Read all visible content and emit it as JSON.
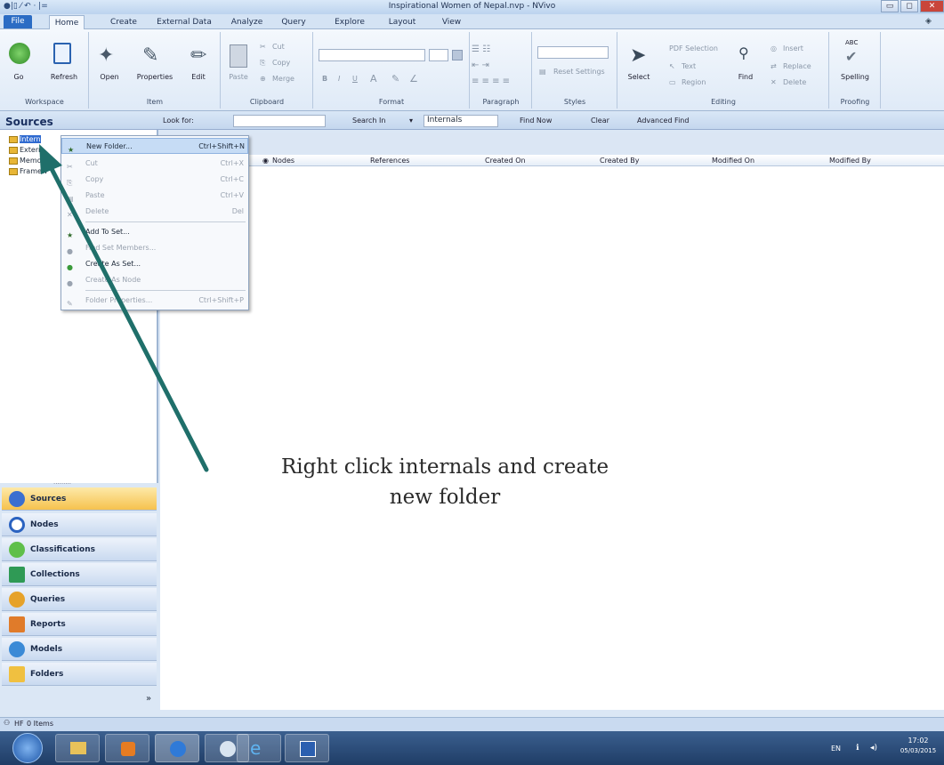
{
  "window": {
    "title": "Inspirational Women of Nepal.nvp - NVivo",
    "qat": "●|▯ ⁄ ↶ · |="
  },
  "tabs": [
    "File",
    "Home",
    "Create",
    "External Data",
    "Analyze",
    "Query",
    "Explore",
    "Layout",
    "View"
  ],
  "ribbon": {
    "workspace": {
      "go": "Go",
      "refresh": "Refresh",
      "label": "Workspace"
    },
    "item": {
      "open": "Open",
      "properties": "Properties",
      "edit": "Edit",
      "label": "Item"
    },
    "clipboard": {
      "paste": "Paste",
      "cut": "Cut",
      "copy": "Copy",
      "merge": "Merge",
      "label": "Clipboard"
    },
    "format": {
      "label": "Format",
      "bold": "B",
      "italic": "I",
      "underline": "U",
      "font_color": "A"
    },
    "paragraph": {
      "label": "Paragraph"
    },
    "styles": {
      "reset": "Reset Settings",
      "label": "Styles"
    },
    "editing": {
      "select": "Select",
      "pdf_selection": "PDF Selection",
      "text": "Text",
      "region": "Region",
      "find": "Find",
      "insert": "Insert",
      "replace": "Replace",
      "delete": "Delete",
      "label": "Editing"
    },
    "proofing": {
      "spelling": "Spelling",
      "abc": "ABC",
      "label": "Proofing"
    }
  },
  "searchbar": {
    "sources": "Sources",
    "look_for": "Look for:",
    "search_in": "Search In",
    "search_in_value": "Internals",
    "find_now": "Find Now",
    "clear": "Clear",
    "advanced_find": "Advanced Find"
  },
  "tree": [
    "Intern",
    "Extern",
    "Memo",
    "Framew"
  ],
  "columns": [
    "Nodes",
    "References",
    "Created On",
    "Created By",
    "Modified On",
    "Modified By"
  ],
  "context_menu": [
    {
      "label": "New Folder...",
      "shortcut": "Ctrl+Shift+N",
      "disabled": false
    },
    {
      "label": "Cut",
      "shortcut": "Ctrl+X",
      "disabled": true
    },
    {
      "label": "Copy",
      "shortcut": "Ctrl+C",
      "disabled": true
    },
    {
      "label": "Paste",
      "shortcut": "Ctrl+V",
      "disabled": true
    },
    {
      "label": "Delete",
      "shortcut": "Del",
      "disabled": true
    },
    {
      "label": "Add To Set...",
      "shortcut": "",
      "disabled": false
    },
    {
      "label": "Find Set Members...",
      "shortcut": "",
      "disabled": true
    },
    {
      "label": "Create As Set...",
      "shortcut": "",
      "disabled": false
    },
    {
      "label": "Create As Node",
      "shortcut": "",
      "disabled": true
    },
    {
      "label": "Folder Properties...",
      "shortcut": "Ctrl+Shift+P",
      "disabled": true
    }
  ],
  "workspace_nav": [
    "Sources",
    "Nodes",
    "Classifications",
    "Collections",
    "Queries",
    "Reports",
    "Models",
    "Folders"
  ],
  "statusbar": {
    "user": "HF",
    "items": "0 Items"
  },
  "taskbar": {
    "lang": "EN",
    "time": "17:02",
    "date": "05/03/2015"
  },
  "caption": {
    "line1": "Right click internals and create",
    "line2": "new folder"
  },
  "colors": {
    "accent": "#2b6cc4",
    "arrow": "#1f6f6a",
    "selected_ws": "#f6c24e"
  }
}
